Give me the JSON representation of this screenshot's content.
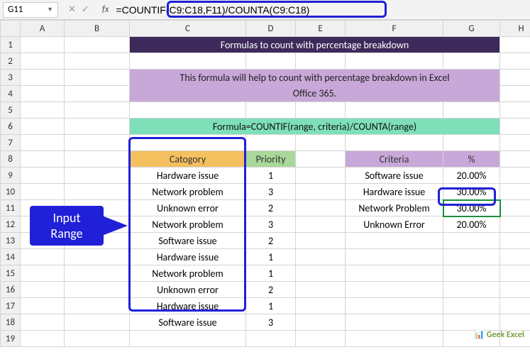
{
  "nameBox": "G11",
  "formula": "=COUNTIF(C9:C18,F11)/COUNTA(C9:C18)",
  "cols": [
    "A",
    "B",
    "C",
    "D",
    "E",
    "F",
    "G",
    "H"
  ],
  "row1": "Formulas to count with percentage breakdown",
  "row3a": "This formula will help to count with percentage breakdown in Excel",
  "row3b": "Office 365.",
  "row6": "Formula=COUNTIF(range, criteria)/COUNTA(range)",
  "hd": {
    "cat": "Catogory",
    "pri": "Priority",
    "crit": "Criteria",
    "pct": "%"
  },
  "cat": [
    "Hardware issue",
    "Network problem",
    "Unknown error",
    "Network problem",
    "Software issue",
    "Hardware issue",
    "Network problem",
    "Unknown error",
    "Hardware issue",
    "Software issue"
  ],
  "pri": [
    "1",
    "3",
    "2",
    "3",
    "2",
    "1",
    "1",
    "2",
    "1",
    "3"
  ],
  "crit": [
    "Software issue",
    "Hardware issue",
    "Network Problem",
    "Unknown Error"
  ],
  "pct": [
    "20.00%",
    "30.00%",
    "30.00%",
    "20.00%"
  ],
  "callout1": "Input",
  "callout2": "Range",
  "watermark": "Geek Excel",
  "chart_data": {
    "type": "table",
    "title": "Formulas to count with percentage breakdown",
    "input_range": {
      "columns": [
        "Catogory",
        "Priority"
      ],
      "rows": [
        [
          "Hardware issue",
          1
        ],
        [
          "Network problem",
          3
        ],
        [
          "Unknown error",
          2
        ],
        [
          "Network problem",
          3
        ],
        [
          "Software issue",
          2
        ],
        [
          "Hardware issue",
          1
        ],
        [
          "Network problem",
          1
        ],
        [
          "Unknown error",
          2
        ],
        [
          "Hardware issue",
          1
        ],
        [
          "Software issue",
          3
        ]
      ]
    },
    "result": {
      "columns": [
        "Criteria",
        "%"
      ],
      "rows": [
        [
          "Software issue",
          0.2
        ],
        [
          "Hardware issue",
          0.3
        ],
        [
          "Network Problem",
          0.3
        ],
        [
          "Unknown Error",
          0.2
        ]
      ]
    },
    "formula": "=COUNTIF(C9:C18,F11)/COUNTA(C9:C18)"
  }
}
